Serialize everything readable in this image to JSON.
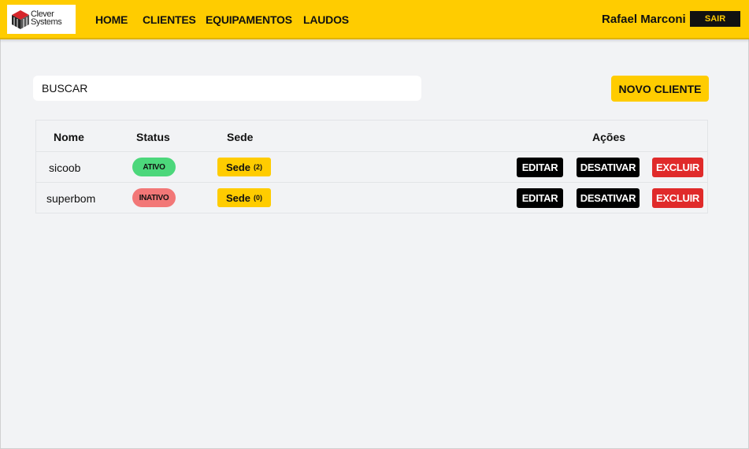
{
  "header": {
    "logo": {
      "line1": "Clever",
      "line2": "Systems"
    },
    "nav": [
      "HOME",
      "CLIENTES",
      "EQUIPAMENTOS",
      "LAUDOS"
    ],
    "user_name": "Rafael Marconi",
    "logout_label": "SAIR"
  },
  "toolbar": {
    "search_placeholder": "BUSCAR",
    "new_client_label": "NOVO CLIENTE"
  },
  "table": {
    "columns": [
      "Nome",
      "Status",
      "Sede",
      "Ações"
    ],
    "rows": [
      {
        "name": "sicoob",
        "status": "ATIVO",
        "status_color": "#4cd77b",
        "sede_label": "Sede",
        "sede_count": "(2)",
        "edit": "EDITAR",
        "deactivate": "DESATIVAR",
        "delete": "EXCLUIR"
      },
      {
        "name": "superbom",
        "status": "INATIVO",
        "status_color": "#f27777",
        "sede_label": "Sede",
        "sede_count": "(0)",
        "edit": "EDITAR",
        "deactivate": "DESATIVAR",
        "delete": "EXCLUIR"
      }
    ]
  },
  "colors": {
    "brand_yellow": "#ffcc00",
    "delete_red": "#e02a2a",
    "active_green": "#4cd77b",
    "inactive_red": "#f27777"
  }
}
